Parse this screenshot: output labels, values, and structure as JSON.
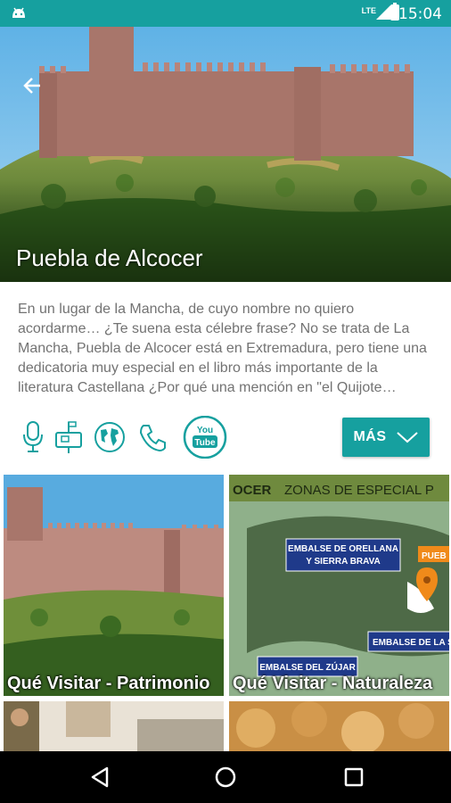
{
  "status_bar": {
    "time": "15:04",
    "network": "LTE"
  },
  "hero": {
    "title": "Puebla de Alcocer"
  },
  "description": {
    "text": "En un lugar de la Mancha, de cuyo nombre no quiero acordarme… ¿Te suena esta célebre frase? No se trata de La Mancha, Puebla de Alcocer está en Extremadura, pero tiene una dedicatoria muy especial en el libro más importante de la literatura Castellana ¿Por qué una mención en \"el Quijote…"
  },
  "actions": {
    "icons": [
      "microphone-icon",
      "mailbox-icon",
      "globe-icon",
      "phone-icon",
      "youtube-icon"
    ],
    "youtube_text": "You Tube",
    "more_label": "MÁS"
  },
  "tiles": [
    {
      "caption": "Qué Visitar - Patrimonio"
    },
    {
      "caption": "Qué Visitar - Naturaleza"
    }
  ],
  "map": {
    "header": "OCER  ZONAS DE ESPECIAL P",
    "labels": [
      "EMBALSE DE ORELLANA",
      "Y SIERRA BRAVA",
      "PUEB",
      "EMBALSE DE LA S",
      "EMBALSE DEL ZÚJAR"
    ]
  },
  "colors": {
    "accent": "#16a09f",
    "status_bar": "#16a09f"
  }
}
